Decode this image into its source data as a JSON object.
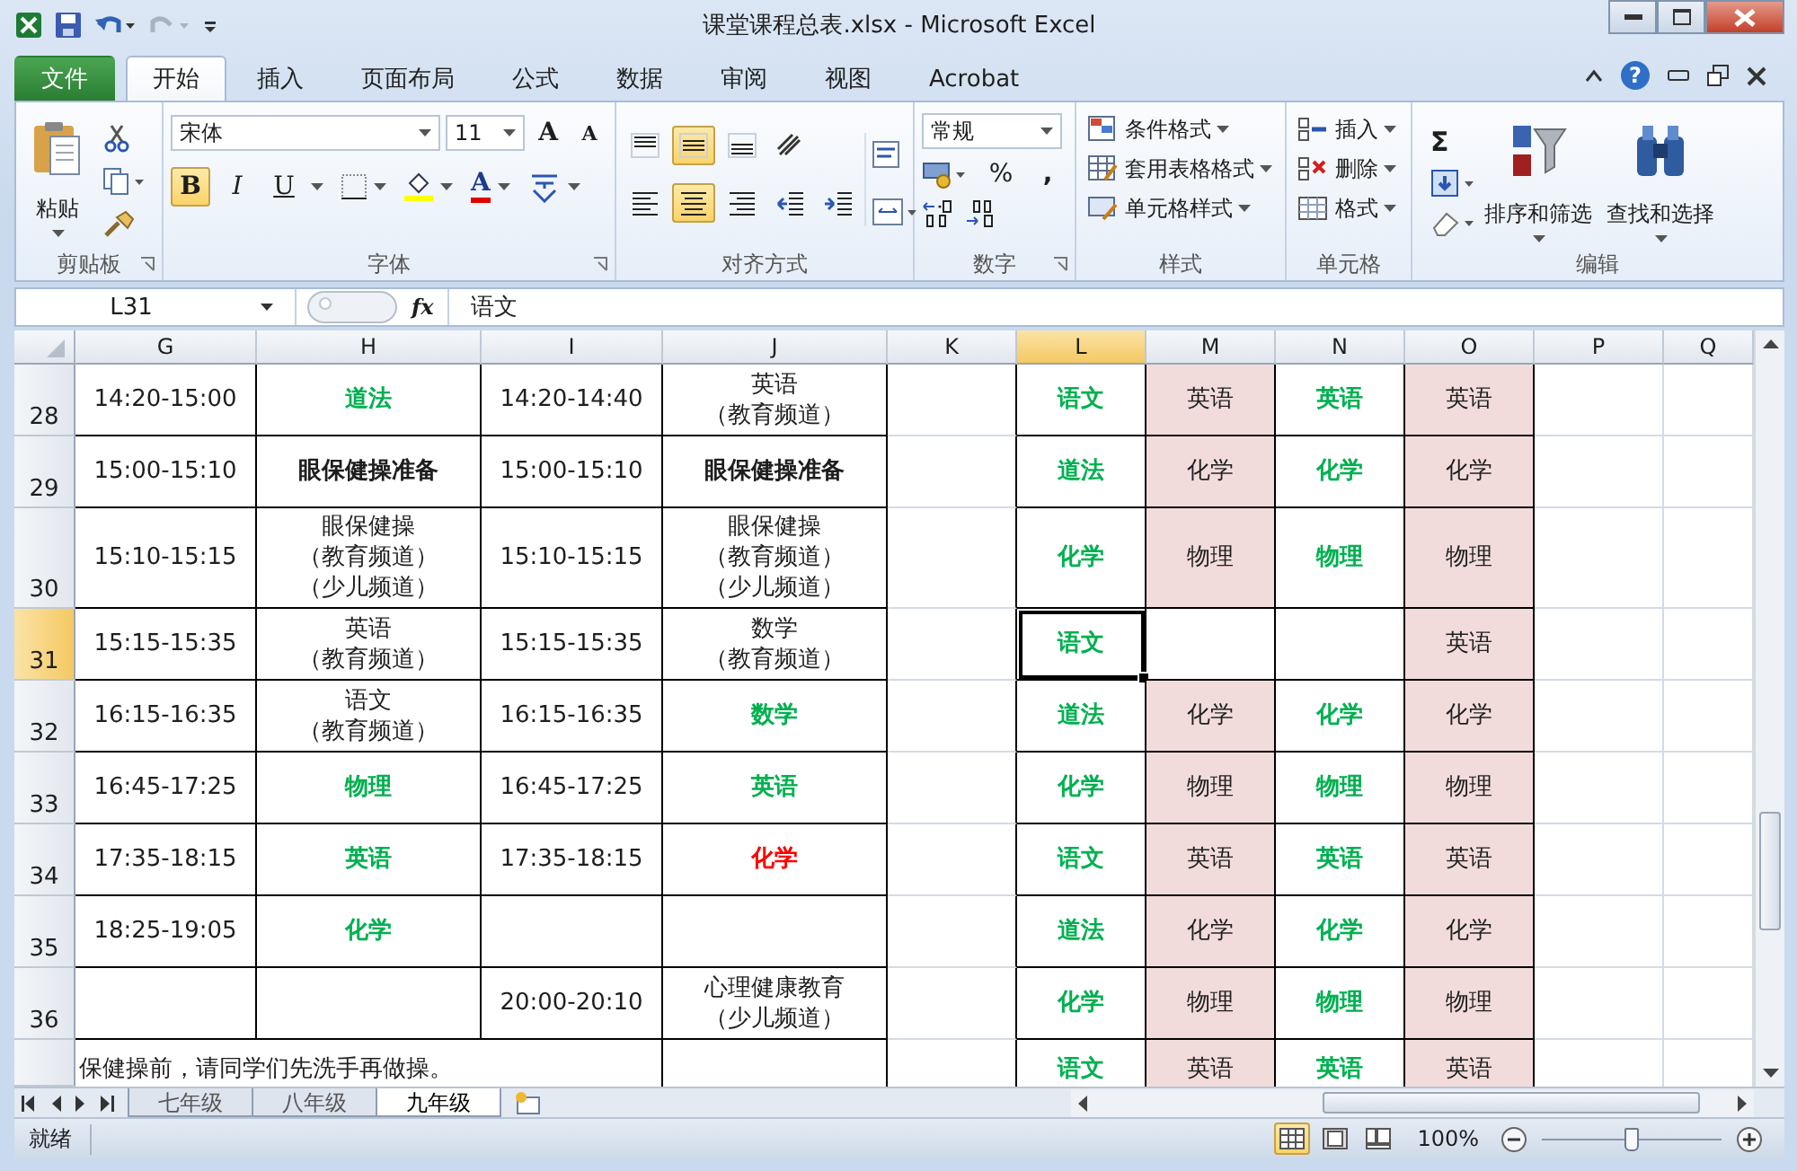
{
  "window": {
    "title": "课堂课程总表.xlsx - Microsoft Excel"
  },
  "ribbon_tabs": [
    {
      "label": "文件",
      "kind": "file",
      "selected": false
    },
    {
      "label": "开始",
      "kind": "tab",
      "selected": true
    },
    {
      "label": "插入",
      "kind": "tab",
      "selected": false
    },
    {
      "label": "页面布局",
      "kind": "tab",
      "selected": false
    },
    {
      "label": "公式",
      "kind": "tab",
      "selected": false
    },
    {
      "label": "数据",
      "kind": "tab",
      "selected": false
    },
    {
      "label": "审阅",
      "kind": "tab",
      "selected": false
    },
    {
      "label": "视图",
      "kind": "tab",
      "selected": false
    },
    {
      "label": "Acrobat",
      "kind": "tab",
      "selected": false
    }
  ],
  "help_glyph": "?",
  "clipboard": {
    "paste": "粘贴",
    "label": "剪贴板"
  },
  "font": {
    "family": "宋体",
    "size": "11",
    "grow": "A",
    "shrink": "A",
    "color_glyph": "A",
    "label": "字体",
    "buttons": [
      {
        "kind": "bold",
        "label": "B",
        "on": true
      },
      {
        "kind": "italic",
        "label": "I",
        "on": false
      },
      {
        "kind": "underline",
        "label": "U",
        "on": false
      }
    ]
  },
  "alignment": {
    "label": "对齐方式",
    "rows": [
      [
        {
          "kind": "top",
          "on": false
        },
        {
          "kind": "middle",
          "on": true
        },
        {
          "kind": "bottom",
          "on": false
        },
        {
          "kind": "orient",
          "on": false
        }
      ],
      [
        {
          "kind": "left",
          "on": false
        },
        {
          "kind": "center",
          "on": true
        },
        {
          "kind": "right",
          "on": false
        },
        {
          "kind": "outdent",
          "on": false
        },
        {
          "kind": "indent",
          "on": false
        }
      ]
    ]
  },
  "number": {
    "format": "常规",
    "percent": "%",
    "comma": ",",
    "label": "数字"
  },
  "styles": {
    "label": "样式",
    "items": [
      {
        "kind": "conditional",
        "label": "条件格式"
      },
      {
        "kind": "table",
        "label": "套用表格格式"
      },
      {
        "kind": "cellstyle",
        "label": "单元格样式"
      }
    ]
  },
  "cells": {
    "label": "单元格",
    "items": [
      {
        "kind": "insert",
        "label": "插入"
      },
      {
        "kind": "delete",
        "label": "删除"
      },
      {
        "kind": "format",
        "label": "格式"
      }
    ]
  },
  "editing": {
    "sum": "Σ",
    "sort": "排序和筛选",
    "find": "查找和选择",
    "label": "编辑"
  },
  "formula_bar": {
    "name_box": "L31",
    "fx": "fx",
    "value": "语文"
  },
  "sheet": {
    "columns": [
      {
        "label": "G",
        "selected": false
      },
      {
        "label": "H",
        "selected": false
      },
      {
        "label": "I",
        "selected": false
      },
      {
        "label": "J",
        "selected": false
      },
      {
        "label": "K",
        "selected": false
      },
      {
        "label": "L",
        "selected": true
      },
      {
        "label": "M",
        "selected": false
      },
      {
        "label": "N",
        "selected": false
      },
      {
        "label": "O",
        "selected": false
      },
      {
        "label": "P",
        "selected": false
      },
      {
        "label": "Q",
        "selected": false
      }
    ],
    "rows": [
      {
        "kind": "data",
        "number": "28",
        "selected": false,
        "cells": [
          {
            "text": "14:20-15:00",
            "kind": "plain"
          },
          {
            "text": "道法",
            "kind": "green"
          },
          {
            "text": "14:20-14:40",
            "kind": "plain"
          },
          {
            "lines": [
              "英语",
              "（教育频道）"
            ],
            "kind": "plain"
          },
          {},
          {
            "text": "语文",
            "kind": "green"
          },
          {
            "text": "英语",
            "kind": "plain",
            "shaded": true
          },
          {
            "text": "英语",
            "kind": "green"
          },
          {
            "text": "英语",
            "kind": "plain",
            "shaded": true
          }
        ]
      },
      {
        "kind": "data",
        "number": "29",
        "selected": false,
        "cells": [
          {
            "text": "15:00-15:10",
            "kind": "plain"
          },
          {
            "text": "眼保健操准备",
            "kind": "bold"
          },
          {
            "text": "15:00-15:10",
            "kind": "plain"
          },
          {
            "text": "眼保健操准备",
            "kind": "bold"
          },
          {},
          {
            "text": "道法",
            "kind": "green"
          },
          {
            "text": "化学",
            "kind": "plain",
            "shaded": true
          },
          {
            "text": "化学",
            "kind": "green"
          },
          {
            "text": "化学",
            "kind": "plain",
            "shaded": true
          }
        ]
      },
      {
        "kind": "data",
        "number": "30",
        "selected": false,
        "cells": [
          {
            "text": "15:10-15:15",
            "kind": "plain"
          },
          {
            "lines": [
              "眼保健操",
              "（教育频道）",
              "（少儿频道）"
            ],
            "kind": "plain"
          },
          {
            "text": "15:10-15:15",
            "kind": "plain"
          },
          {
            "lines": [
              "眼保健操",
              "（教育频道）",
              "（少儿频道）"
            ],
            "kind": "plain"
          },
          {},
          {
            "text": "化学",
            "kind": "green"
          },
          {
            "text": "物理",
            "kind": "plain",
            "shaded": true
          },
          {
            "text": "物理",
            "kind": "green"
          },
          {
            "text": "物理",
            "kind": "plain",
            "shaded": true
          }
        ]
      },
      {
        "kind": "data",
        "number": "31",
        "selected": true,
        "cells": [
          {
            "text": "15:15-15:35",
            "kind": "plain"
          },
          {
            "lines": [
              "英语",
              "（教育频道）"
            ],
            "kind": "plain"
          },
          {
            "text": "15:15-15:35",
            "kind": "plain"
          },
          {
            "lines": [
              "数学",
              "（教育频道）"
            ],
            "kind": "plain"
          },
          {},
          {
            "text": "语文",
            "kind": "green"
          },
          {},
          {},
          {
            "text": "英语",
            "kind": "plain",
            "shaded": true
          }
        ]
      },
      {
        "kind": "data",
        "number": "32",
        "selected": false,
        "cells": [
          {
            "text": "16:15-16:35",
            "kind": "plain"
          },
          {
            "lines": [
              "语文",
              "（教育频道）"
            ],
            "kind": "plain"
          },
          {
            "text": "16:15-16:35",
            "kind": "plain"
          },
          {
            "text": "数学",
            "kind": "green"
          },
          {},
          {
            "text": "道法",
            "kind": "green"
          },
          {
            "text": "化学",
            "kind": "plain",
            "shaded": true
          },
          {
            "text": "化学",
            "kind": "green"
          },
          {
            "text": "化学",
            "kind": "plain",
            "shaded": true
          }
        ]
      },
      {
        "kind": "data",
        "number": "33",
        "selected": false,
        "cells": [
          {
            "text": "16:45-17:25",
            "kind": "plain"
          },
          {
            "text": "物理",
            "kind": "green"
          },
          {
            "text": "16:45-17:25",
            "kind": "plain"
          },
          {
            "text": "英语",
            "kind": "green"
          },
          {},
          {
            "text": "化学",
            "kind": "green"
          },
          {
            "text": "物理",
            "kind": "plain",
            "shaded": true
          },
          {
            "text": "物理",
            "kind": "green"
          },
          {
            "text": "物理",
            "kind": "plain",
            "shaded": true
          }
        ]
      },
      {
        "kind": "data",
        "number": "34",
        "selected": false,
        "cells": [
          {
            "text": "17:35-18:15",
            "kind": "plain"
          },
          {
            "text": "英语",
            "kind": "green"
          },
          {
            "text": "17:35-18:15",
            "kind": "plain"
          },
          {
            "text": "化学",
            "kind": "red"
          },
          {},
          {
            "text": "语文",
            "kind": "green"
          },
          {
            "text": "英语",
            "kind": "plain",
            "shaded": true
          },
          {
            "text": "英语",
            "kind": "green"
          },
          {
            "text": "英语",
            "kind": "plain",
            "shaded": true
          }
        ]
      },
      {
        "kind": "data",
        "number": "35",
        "selected": false,
        "cells": [
          {
            "text": "18:25-19:05",
            "kind": "plain"
          },
          {
            "text": "化学",
            "kind": "green"
          },
          {},
          {},
          {},
          {
            "text": "道法",
            "kind": "green"
          },
          {
            "text": "化学",
            "kind": "plain",
            "shaded": true
          },
          {
            "text": "化学",
            "kind": "green"
          },
          {
            "text": "化学",
            "kind": "plain",
            "shaded": true
          }
        ]
      },
      {
        "kind": "data",
        "number": "36",
        "selected": false,
        "cells": [
          {},
          {},
          {
            "text": "20:00-20:10",
            "kind": "plain"
          },
          {
            "lines": [
              "心理健康教育",
              "（少儿频道）"
            ],
            "kind": "plain"
          },
          {},
          {
            "text": "化学",
            "kind": "green"
          },
          {
            "text": "物理",
            "kind": "plain",
            "shaded": true
          },
          {
            "text": "物理",
            "kind": "green"
          },
          {
            "text": "物理",
            "kind": "plain",
            "shaded": true
          }
        ]
      },
      {
        "kind": "note",
        "selected": false,
        "cells": [
          {
            "text": "保健操前，请同学们先洗手再做操。",
            "kind": "plain"
          },
          {},
          {},
          {},
          {},
          {
            "text": "语文",
            "kind": "green"
          },
          {
            "text": "英语",
            "kind": "plain",
            "shaded": true
          },
          {
            "text": "英语",
            "kind": "green"
          },
          {
            "text": "英语",
            "kind": "plain",
            "shaded": true
          }
        ]
      }
    ]
  },
  "sheet_tabs": [
    {
      "label": "七年级",
      "selected": false
    },
    {
      "label": "八年级",
      "selected": false
    },
    {
      "label": "九年级",
      "selected": true
    }
  ],
  "status_bar": {
    "text": "就绪",
    "zoom": "100%",
    "zoom_slider": {
      "level": 0.5
    },
    "views": [
      {
        "kind": "normal",
        "selected": true
      },
      {
        "kind": "layout",
        "selected": false
      },
      {
        "kind": "break",
        "selected": false
      }
    ]
  }
}
